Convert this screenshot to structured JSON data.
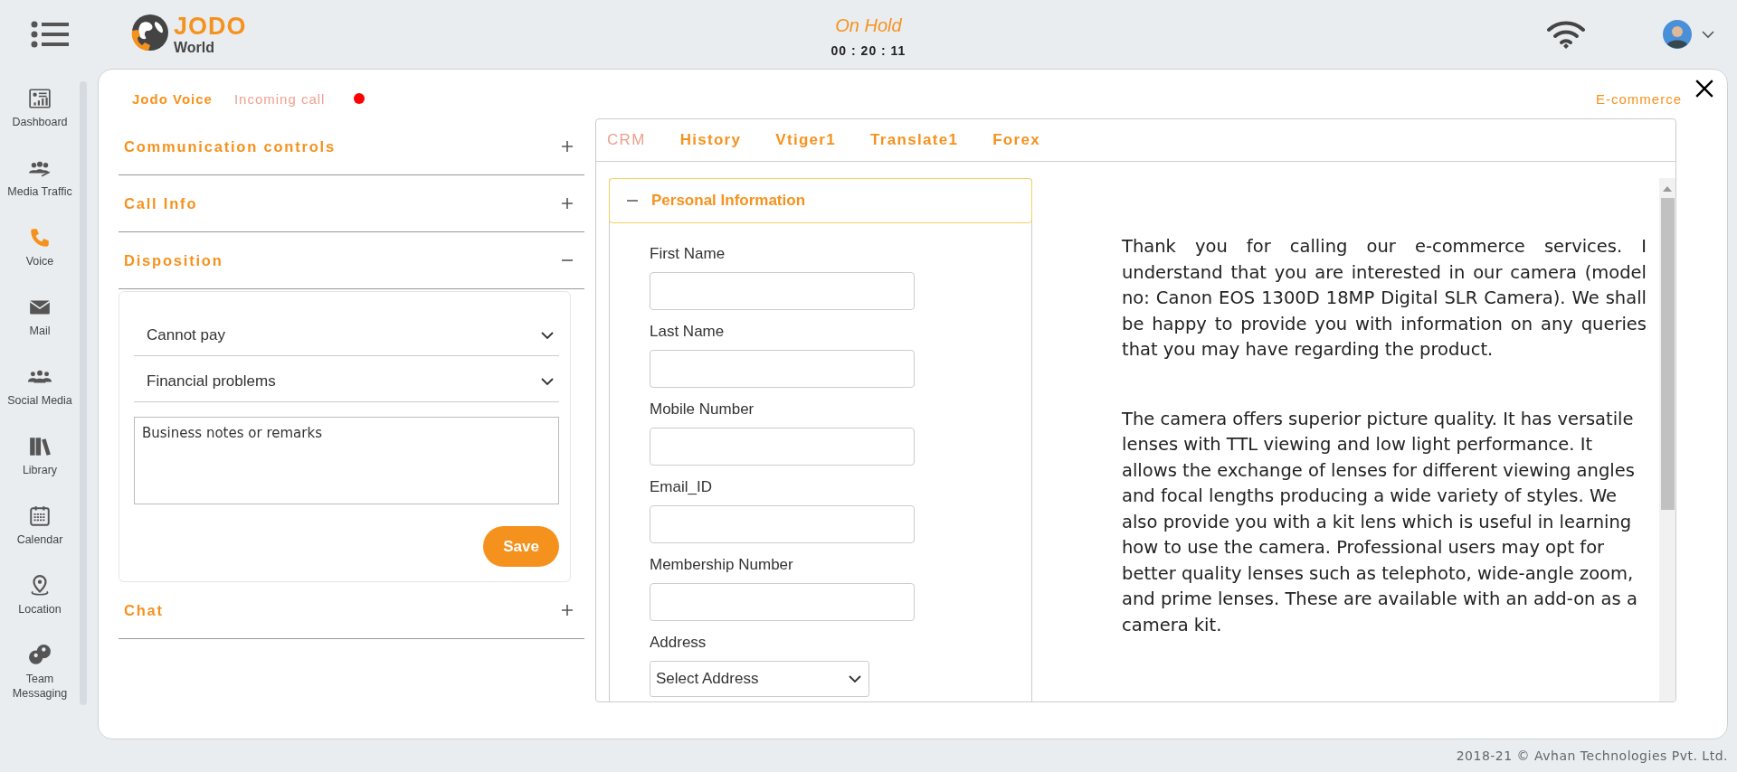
{
  "brand": {
    "name": "JODO",
    "subtitle": "World"
  },
  "call_status": {
    "status": "On Hold",
    "timer": "00 : 20 : 11"
  },
  "sidebar": {
    "items": [
      {
        "label": "Dashboard",
        "selected": false
      },
      {
        "label": "Media Traffic",
        "selected": false
      },
      {
        "label": "Voice",
        "selected": true
      },
      {
        "label": "Mail",
        "selected": false
      },
      {
        "label": "Social Media",
        "selected": false
      },
      {
        "label": "Library",
        "selected": false
      },
      {
        "label": "Calendar",
        "selected": false
      },
      {
        "label": "Location",
        "selected": false
      },
      {
        "label": "Team Messaging",
        "selected": false
      }
    ]
  },
  "panel_header": {
    "app": "Jodo Voice",
    "call_state": "Incoming call",
    "live": true,
    "category": "E-commerce"
  },
  "accordions": [
    {
      "title": "Communication controls",
      "expanded": false
    },
    {
      "title": "Call Info",
      "expanded": false
    },
    {
      "title": "Disposition",
      "expanded": true
    },
    {
      "title": "Chat",
      "expanded": false
    }
  ],
  "disposition": {
    "selects": [
      "Cannot pay",
      "Financial problems"
    ],
    "notes": {
      "placeholder": "Business notes or remarks"
    },
    "button": "Save"
  },
  "tabs": [
    {
      "label": "CRM",
      "selected": true
    },
    {
      "label": "History",
      "selected": false
    },
    {
      "label": "Vtiger1",
      "selected": false
    },
    {
      "label": "Translate1",
      "selected": false
    },
    {
      "label": "Forex",
      "selected": false
    }
  ],
  "personal_information": {
    "title": "Personal Information",
    "expanded": true,
    "fields": [
      {
        "label": "First Name",
        "kind": "text"
      },
      {
        "label": "Last Name",
        "kind": "text"
      },
      {
        "label": "Mobile Number",
        "kind": "text"
      },
      {
        "label": "Email_ID",
        "kind": "text"
      },
      {
        "label": "Membership Number",
        "kind": "text"
      },
      {
        "label": "Address",
        "kind": "select",
        "value": "Select Address"
      }
    ]
  },
  "script": {
    "paragraphs": [
      {
        "text": "Thank you for calling our e-commerce services. I understand that you are interested in our camera (model no: Canon EOS 1300D 18MP Digital SLR Camera). We shall be happy to provide you with information on any queries that you may have regarding the product.",
        "justified": true
      },
      {
        "text": "The camera offers superior picture quality. It has versatile lenses with TTL viewing and low light performance. It allows the exchange of lenses for different viewing angles and focal lengths producing a wide variety of styles. We also provide you with a kit lens which is useful in learning how to use the camera. Professional users may opt for better quality lenses such as telephoto, wide-angle zoom, and prime lenses. These are available with an add-on as a camera kit.",
        "justified": false
      }
    ]
  },
  "footer": "2018-21 © Avhan Technologies Pvt. Ltd."
}
